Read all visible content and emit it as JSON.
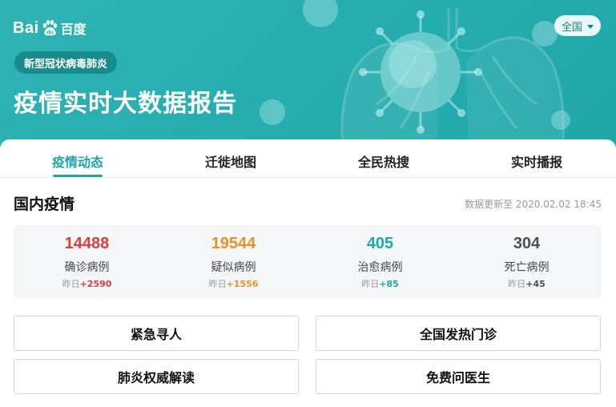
{
  "brand": {
    "logo_text": "Bai",
    "logo_paw_text": "du",
    "logo_cn": "百度"
  },
  "header": {
    "region_selector": "全国",
    "tag": "新型冠状病毒肺炎",
    "title": "疫情实时大数据报告"
  },
  "tabs": [
    {
      "label": "疫情动态",
      "active": true
    },
    {
      "label": "迁徙地图",
      "active": false
    },
    {
      "label": "全民热搜",
      "active": false
    },
    {
      "label": "实时播报",
      "active": false
    }
  ],
  "section": {
    "title": "国内疫情",
    "update_time": "数据更新至 2020.02.02 18:45"
  },
  "stats": [
    {
      "value": "14488",
      "label": "确诊病例",
      "delta_prefix": "昨日",
      "delta": "+2590",
      "color": "#e03a3a"
    },
    {
      "value": "19544",
      "label": "疑似病例",
      "delta_prefix": "昨日",
      "delta": "+1556",
      "color": "#e8912a"
    },
    {
      "value": "405",
      "label": "治愈病例",
      "delta_prefix": "昨日",
      "delta": "+85",
      "color": "#1fa6a9"
    },
    {
      "value": "304",
      "label": "死亡病例",
      "delta_prefix": "昨日",
      "delta": "+45",
      "color": "#4a4f5a"
    }
  ],
  "actions": {
    "search_person": "紧急寻人",
    "fever_clinics": "全国发热门诊",
    "pneumonia_guide": "肺炎权威解读",
    "ask_doctor": "免费问医生"
  },
  "colors": {
    "brand_teal": "#27aeb0",
    "accent": "#1fa6a9"
  }
}
